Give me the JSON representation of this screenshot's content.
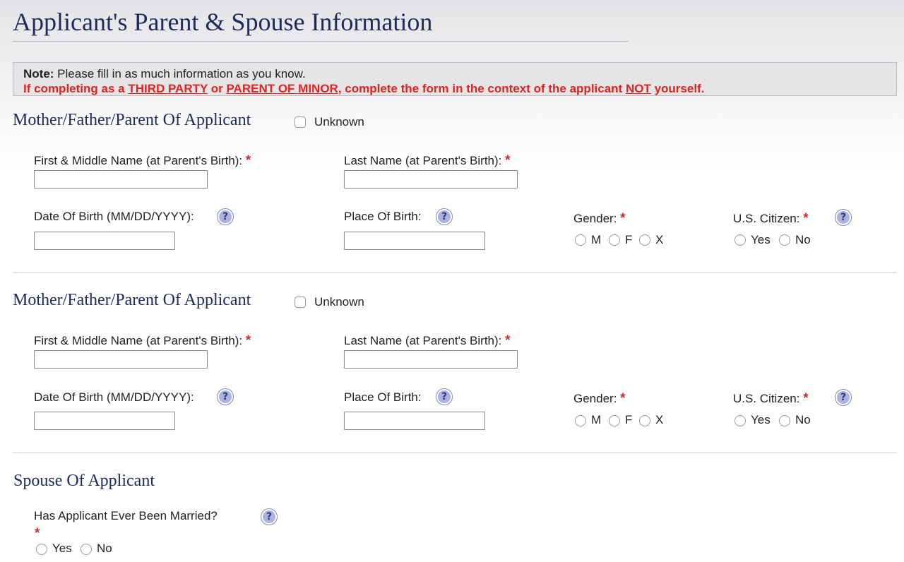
{
  "page_title": "Applicant's Parent & Spouse Information",
  "note": {
    "bold_label": "Note:",
    "text": " Please fill in as much information as you know.",
    "line2_parts": [
      "If completing as a ",
      "THIRD PARTY",
      " or ",
      "PARENT OF MINOR",
      ", complete the form in the context of the applicant ",
      "NOT",
      " yourself."
    ]
  },
  "parents": [
    {
      "title": "Mother/Father/Parent Of Applicant",
      "unknown_label": "Unknown",
      "first_name_label": "First & Middle Name (at Parent's Birth):",
      "last_name_label": "Last Name (at Parent's Birth):",
      "dob_label": "Date Of Birth (MM/DD/YYYY):",
      "pob_label": "Place Of Birth:",
      "gender_label": "Gender:",
      "gender_options": [
        "M",
        "F",
        "X"
      ],
      "citizen_label": "U.S. Citizen:",
      "citizen_options": [
        "Yes",
        "No"
      ],
      "first_name_value": "",
      "last_name_value": "",
      "dob_value": "",
      "pob_value": ""
    },
    {
      "title": "Mother/Father/Parent Of Applicant",
      "unknown_label": "Unknown",
      "first_name_label": "First & Middle Name (at Parent's Birth):",
      "last_name_label": "Last Name (at Parent's Birth):",
      "dob_label": "Date Of Birth (MM/DD/YYYY):",
      "pob_label": "Place Of Birth:",
      "gender_label": "Gender:",
      "gender_options": [
        "M",
        "F",
        "X"
      ],
      "citizen_label": "U.S. Citizen:",
      "citizen_options": [
        "Yes",
        "No"
      ],
      "first_name_value": "",
      "last_name_value": "",
      "dob_value": "",
      "pob_value": ""
    }
  ],
  "spouse": {
    "title": "Spouse Of Applicant",
    "married_label": "Has Applicant Ever Been Married?",
    "married_options": [
      "Yes",
      "No"
    ]
  },
  "required_marker": "*",
  "help_glyph": "?",
  "icons": {
    "help": "question-mark-circle-icon"
  },
  "colors": {
    "heading": "#1c2c5c",
    "warning_text": "#e3231b",
    "required_star": "#d12a2a",
    "help_icon_fill": "#aab3de"
  }
}
